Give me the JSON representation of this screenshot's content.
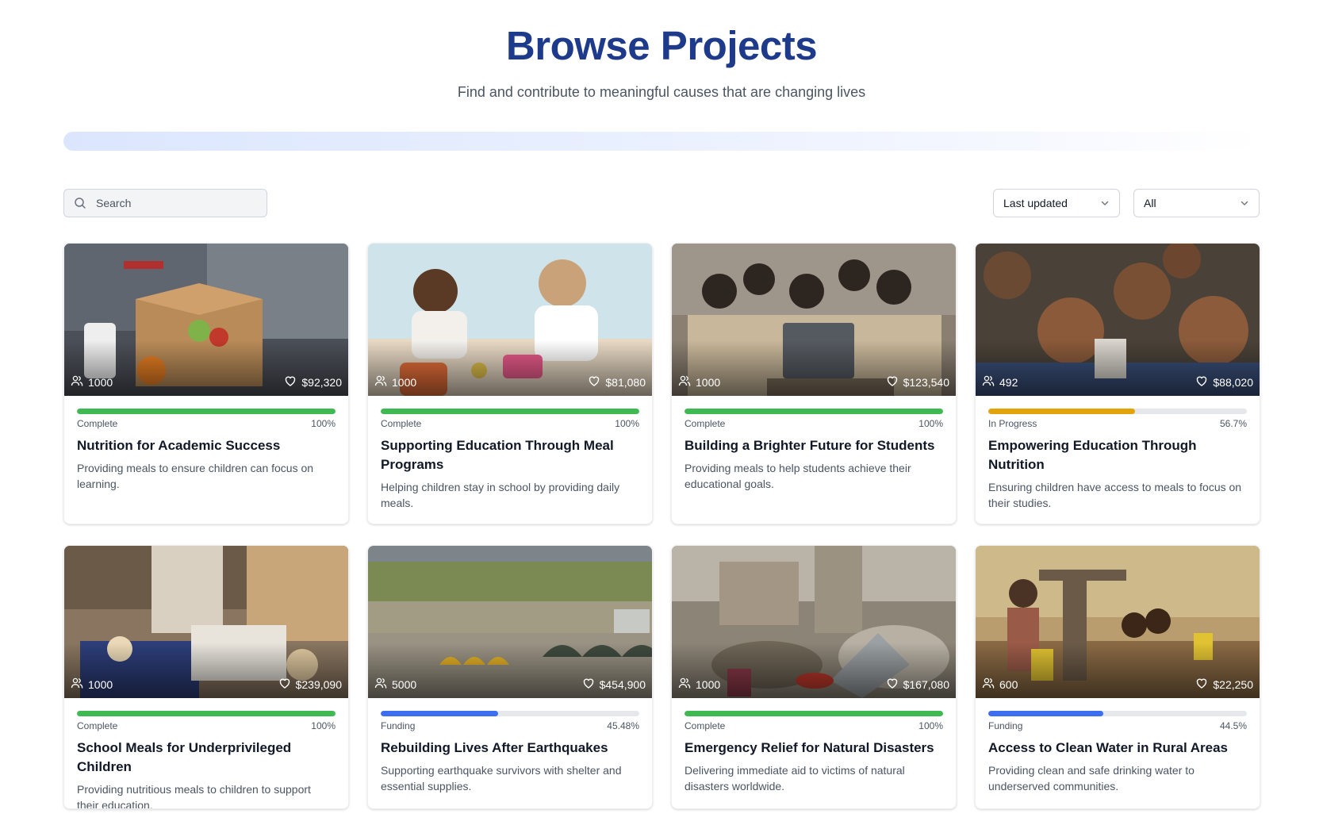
{
  "header": {
    "title": "Browse Projects",
    "subtitle": "Find and contribute to meaningful causes that are changing lives"
  },
  "toolbar": {
    "search_placeholder": "Search",
    "sort_value": "Last updated",
    "filter_value": "All"
  },
  "colors": {
    "title": "#1e3a8a",
    "complete": "#3fba52",
    "in_progress": "#e2a40a",
    "funding": "#3b6ef0"
  },
  "projects": [
    {
      "supporters": "1000",
      "raised": "$92,320",
      "status": "Complete",
      "percent_label": "100%",
      "progress": 100,
      "status_kind": "complete",
      "title": "Nutrition for Academic Success",
      "description": "Providing meals to ensure children can focus on learning.",
      "image_theme": "volunteer-food-box"
    },
    {
      "supporters": "1000",
      "raised": "$81,080",
      "status": "Complete",
      "percent_label": "100%",
      "progress": 100,
      "status_kind": "complete",
      "title": "Supporting Education Through Meal Programs",
      "description": "Helping children stay in school by providing daily meals.",
      "image_theme": "kids-eating-lunch"
    },
    {
      "supporters": "1000",
      "raised": "$123,540",
      "status": "Complete",
      "percent_label": "100%",
      "progress": 100,
      "status_kind": "complete",
      "title": "Building a Brighter Future for Students",
      "description": "Providing meals to help students achieve their educational goals.",
      "image_theme": "students-laptop"
    },
    {
      "supporters": "492",
      "raised": "$88,020",
      "status": "In Progress",
      "percent_label": "56.7%",
      "progress": 56.7,
      "status_kind": "in_progress",
      "title": "Empowering Education Through Nutrition",
      "description": "Ensuring children have access to meals to focus on their studies.",
      "image_theme": "smiling-children"
    },
    {
      "supporters": "1000",
      "raised": "$239,090",
      "status": "Complete",
      "percent_label": "100%",
      "progress": 100,
      "status_kind": "complete",
      "title": "School Meals for Underprivileged Children",
      "description": "Providing nutritious meals to children to support their education.",
      "image_theme": "packing-food"
    },
    {
      "supporters": "5000",
      "raised": "$454,900",
      "status": "Funding",
      "percent_label": "45.48%",
      "progress": 45.48,
      "status_kind": "funding",
      "title": "Rebuilding Lives After Earthquakes",
      "description": "Supporting earthquake survivors with shelter and essential supplies.",
      "image_theme": "tent-camp"
    },
    {
      "supporters": "1000",
      "raised": "$167,080",
      "status": "Complete",
      "percent_label": "100%",
      "progress": 100,
      "status_kind": "complete",
      "title": "Emergency Relief for Natural Disasters",
      "description": "Delivering immediate aid to victims of natural disasters worldwide.",
      "image_theme": "rubble"
    },
    {
      "supporters": "600",
      "raised": "$22,250",
      "status": "Funding",
      "percent_label": "44.5%",
      "progress": 44.5,
      "status_kind": "funding",
      "title": "Access to Clean Water in Rural Areas",
      "description": "Providing clean and safe drinking water to underserved communities.",
      "image_theme": "water-pump"
    }
  ]
}
